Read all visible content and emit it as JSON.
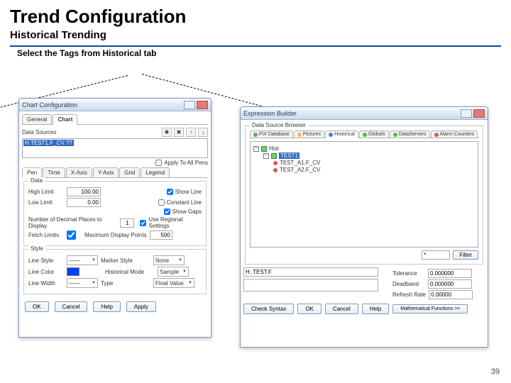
{
  "slide": {
    "title": "Trend Configuration",
    "subtitle": "Historical Trending",
    "instruction": "Select the Tags from Historical tab",
    "page": "39"
  },
  "chartcfg": {
    "wtitle": "Chart Configuration",
    "main_tabs": {
      "general": "General",
      "chart": "Chart"
    },
    "section_ds": "Data Sources",
    "selected_expr": "H.TEST1.F_CV  ??",
    "icon_add": "✱",
    "icon_del": "✖",
    "icon_up": "↑",
    "icon_dn": "↓",
    "pen_tabs": {
      "pen": "Pen",
      "time": "Time",
      "xaxis": "X-Axis",
      "yaxis": "Y-Axis",
      "grid": "Grid",
      "legend": "Legend"
    },
    "data_legend": "Data",
    "high": {
      "label": "High Limit",
      "val": "100.00"
    },
    "low": {
      "label": "Low Limit",
      "val": "0.00"
    },
    "dec": {
      "label": "Number of Decimal Places to Display",
      "val": "1"
    },
    "fetch": {
      "label": "Fetch Limits",
      "chk": true
    },
    "max": {
      "label": "Maximum Display Points",
      "val": "500"
    },
    "cbs": {
      "show": "Show Line",
      "const": "Constant Line",
      "gaps": "Show Gaps",
      "regions": "Use Regional Settings"
    },
    "style_legend": "Style",
    "linestyle": {
      "label": "Line Style",
      "v": "——"
    },
    "linecolor": {
      "label": "Line Color"
    },
    "linewidth": {
      "label": "Line Width",
      "v": "——"
    },
    "marker": {
      "label": "Marker Style",
      "v": "None"
    },
    "hmode": {
      "label": "Historical Mode",
      "v": "Sample"
    },
    "type": {
      "label": "Type",
      "v": "Float Value"
    },
    "apply_all": "Apply To All Pens",
    "btns": {
      "ok": "OK",
      "cancel": "Cancel",
      "help": "Help",
      "apply": "Apply"
    }
  },
  "expr": {
    "wtitle": "Expression Builder",
    "section": "Data Source Browser",
    "dstabs": {
      "fix": "FIX Database",
      "pic": "Pictures",
      "hist": "Historical",
      "globals": "Globals",
      "dataservers": "DataServers",
      "alarm": "Alarm Counters"
    },
    "tree": {
      "root": "Hist",
      "node": "TEST1",
      "l1": "TEST_A1.F_CV",
      "l2": "TEST_A2.F_CV"
    },
    "filter_label": "Filter",
    "expr_label": "H..TEST.F      ",
    "tol": {
      "label": "Tolerance",
      "val": "0.000000"
    },
    "dead": {
      "label": "Deadband",
      "val": "0.000000"
    },
    "refresh": {
      "label": "Refresh Rate",
      "val": "0.00000"
    },
    "btns": {
      "check": "Check Syntax",
      "ok": "OK",
      "cancel": "Cancel",
      "help": "Help",
      "math": "Mathematical Functions >>"
    }
  }
}
